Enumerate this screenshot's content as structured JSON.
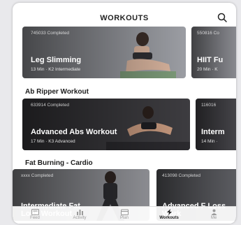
{
  "header": {
    "title": "WORKOUTS",
    "search_icon": "search-icon"
  },
  "sections": [
    {
      "title": "",
      "cards": [
        {
          "completed": "745033 Completed",
          "name": "Leg Slimming",
          "sub": "13 Min · K2 Intermediate"
        },
        {
          "completed": "550816 Co",
          "name": "HIIT Fu",
          "sub": "20 Min · K"
        }
      ]
    },
    {
      "title": "Ab Ripper Workout",
      "cards": [
        {
          "completed": "633914 Completed",
          "name": "Advanced Abs Workout",
          "sub": "17 Min · K3 Advanced"
        },
        {
          "completed": "116016",
          "name": "Interm",
          "sub": "14 Min ·"
        }
      ]
    },
    {
      "title": "Fat Burning - Cardio",
      "cards": [
        {
          "completed": "xxxx Completed",
          "name": "Intermediate Fat Loss Workout",
          "sub": ""
        },
        {
          "completed": "413098 Completed",
          "name": "Advanced F Loss Work",
          "sub": ""
        }
      ]
    }
  ],
  "tabbar": {
    "tabs": [
      {
        "label": "Feed",
        "icon": "feed-icon",
        "active": false
      },
      {
        "label": "Activity",
        "icon": "activity-icon",
        "active": false
      },
      {
        "label": "Plan",
        "icon": "plan-icon",
        "active": false
      },
      {
        "label": "Workouts",
        "icon": "workouts-icon",
        "active": true
      },
      {
        "label": "Me",
        "icon": "me-icon",
        "active": false
      }
    ]
  },
  "colors": {
    "accent": "#1d1d1d",
    "inactive": "#9a9a9a"
  }
}
